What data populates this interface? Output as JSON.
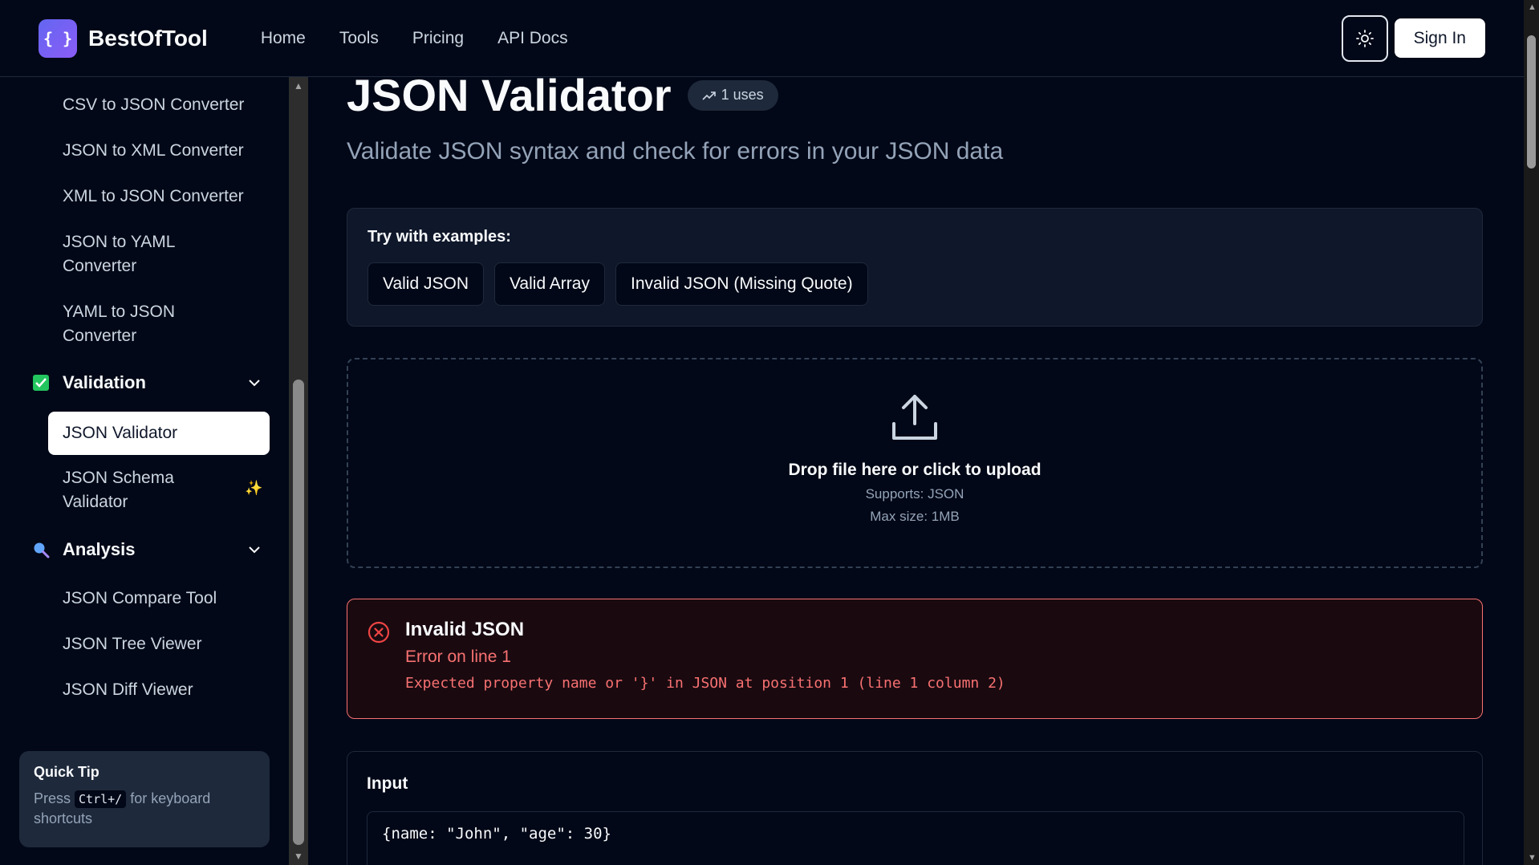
{
  "header": {
    "logo_glyph": "{ }",
    "brand": "BestOfTool",
    "nav": [
      "Home",
      "Tools",
      "Pricing",
      "API Docs"
    ],
    "sign_in": "Sign In"
  },
  "sidebar": {
    "items_top": [
      "CSV to JSON Converter",
      "JSON to XML Converter",
      "XML to JSON Converter",
      "JSON to YAML Converter",
      "YAML to JSON Converter"
    ],
    "validation_group": "Validation",
    "validation_items": [
      "JSON Validator",
      "JSON Schema Validator"
    ],
    "analysis_group": "Analysis",
    "analysis_items": [
      "JSON Compare Tool",
      "JSON Tree Viewer",
      "JSON Diff Viewer"
    ],
    "quick_tip": {
      "title": "Quick Tip",
      "press": "Press",
      "shortcut": "Ctrl+/",
      "suffix": "for keyboard shortcuts"
    }
  },
  "main": {
    "title": "JSON Validator",
    "uses": "1 uses",
    "subtitle": "Validate JSON syntax and check for errors in your JSON data",
    "examples_title": "Try with examples:",
    "examples": [
      "Valid JSON",
      "Valid Array",
      "Invalid JSON (Missing Quote)"
    ],
    "dropzone": {
      "title": "Drop file here or click to upload",
      "supports": "Supports: JSON",
      "max_size": "Max size: 1MB"
    },
    "error": {
      "title": "Invalid JSON",
      "line": "Error on line 1",
      "message": "Expected property name or '}' in JSON at position 1 (line 1 column 2)"
    },
    "input": {
      "label": "Input",
      "value": "{name: \"John\", \"age\": 30}"
    }
  },
  "colors": {
    "background": "#020817",
    "accent": "#6366f1",
    "error": "#f87171"
  }
}
